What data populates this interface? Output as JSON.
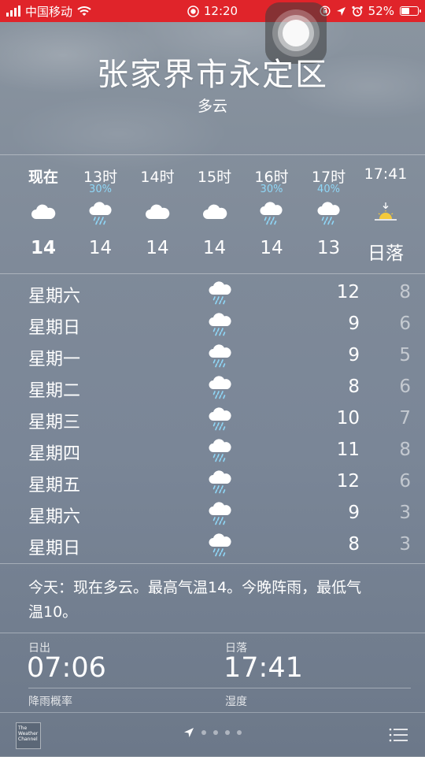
{
  "status_bar": {
    "carrier": "中国移动",
    "time": "12:20",
    "battery": "52%",
    "battery_level": 0.52,
    "accent_color": "#e0242a"
  },
  "location": {
    "city": "张家界市永定区",
    "condition": "多云"
  },
  "hourly": [
    {
      "time": "现在",
      "precip": "",
      "icon": "cloud-icon",
      "temp": "14"
    },
    {
      "time": "13时",
      "precip": "30%",
      "icon": "rain-cloud-icon",
      "temp": "14"
    },
    {
      "time": "14时",
      "precip": "",
      "icon": "cloud-icon",
      "temp": "14"
    },
    {
      "time": "15时",
      "precip": "",
      "icon": "cloud-icon",
      "temp": "14"
    },
    {
      "time": "16时",
      "precip": "30%",
      "icon": "rain-cloud-icon",
      "temp": "14"
    },
    {
      "time": "17时",
      "precip": "40%",
      "icon": "rain-cloud-icon",
      "temp": "13"
    },
    {
      "time": "17:41",
      "precip": "",
      "icon": "sunset-icon",
      "temp": "日落"
    }
  ],
  "daily": [
    {
      "day": "星期六",
      "icon": "rain-cloud-icon",
      "high": "12",
      "low": "8"
    },
    {
      "day": "星期日",
      "icon": "rain-cloud-icon",
      "high": "9",
      "low": "6"
    },
    {
      "day": "星期一",
      "icon": "rain-cloud-icon",
      "high": "9",
      "low": "5"
    },
    {
      "day": "星期二",
      "icon": "rain-cloud-icon",
      "high": "8",
      "low": "6"
    },
    {
      "day": "星期三",
      "icon": "rain-cloud-icon",
      "high": "10",
      "low": "7"
    },
    {
      "day": "星期四",
      "icon": "rain-cloud-icon",
      "high": "11",
      "low": "8"
    },
    {
      "day": "星期五",
      "icon": "rain-cloud-icon",
      "high": "12",
      "low": "6"
    },
    {
      "day": "星期六",
      "icon": "rain-cloud-icon",
      "high": "9",
      "low": "3"
    },
    {
      "day": "星期日",
      "icon": "rain-cloud-icon",
      "high": "8",
      "low": "3"
    }
  ],
  "summary": {
    "line1": "今天：现在多云。最高气温14。今晚阵雨，最低气",
    "line2": "温10。"
  },
  "details": {
    "sunrise_label": "日出",
    "sunrise_value": "07:06",
    "sunset_label": "日落",
    "sunset_value": "17:41",
    "rain_label": "降雨概率",
    "humidity_label": "湿度"
  },
  "footer": {
    "logo_text": "The Weather Channel",
    "page_count": 4,
    "icons": [
      "location-arrow-icon",
      "list-icon"
    ]
  },
  "colors": {
    "precip_text": "#8fd7f7",
    "status_bar_bg": "#e0242a"
  }
}
